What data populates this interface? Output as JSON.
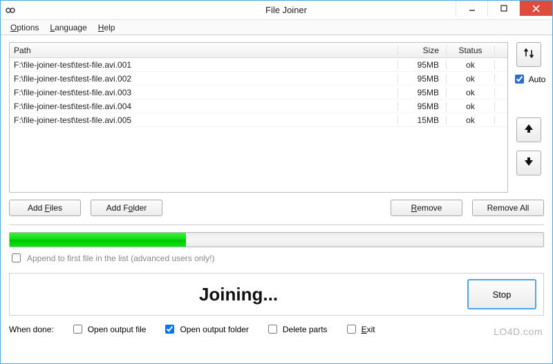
{
  "window": {
    "title": "File Joiner"
  },
  "menubar": {
    "options": "Options",
    "language": "Language",
    "help": "Help"
  },
  "table": {
    "headers": {
      "path": "Path",
      "size": "Size",
      "status": "Status"
    },
    "rows": [
      {
        "path": "F:\\file-joiner-test\\test-file.avi.001",
        "size": "95MB",
        "status": "ok"
      },
      {
        "path": "F:\\file-joiner-test\\test-file.avi.002",
        "size": "95MB",
        "status": "ok"
      },
      {
        "path": "F:\\file-joiner-test\\test-file.avi.003",
        "size": "95MB",
        "status": "ok"
      },
      {
        "path": "F:\\file-joiner-test\\test-file.avi.004",
        "size": "95MB",
        "status": "ok"
      },
      {
        "path": "F:\\file-joiner-test\\test-file.avi.005",
        "size": "15MB",
        "status": "ok"
      }
    ]
  },
  "side": {
    "auto_label": "Auto",
    "auto_checked": true
  },
  "buttons": {
    "add_files": "Add Files",
    "add_folder": "Add Folder",
    "remove": "Remove",
    "remove_all": "Remove All"
  },
  "progress": {
    "percent": 33
  },
  "append": {
    "label": "Append to first file in the list (advanced users only!)",
    "checked": false
  },
  "status": {
    "text": "Joining...",
    "stop": "Stop"
  },
  "done": {
    "label": "When done:",
    "open_file": "Open output file",
    "open_folder": "Open output folder",
    "delete_parts": "Delete parts",
    "exit": "Exit",
    "open_file_checked": false,
    "open_folder_checked": true,
    "delete_parts_checked": false,
    "exit_checked": false
  },
  "watermark": "LO4D.com"
}
